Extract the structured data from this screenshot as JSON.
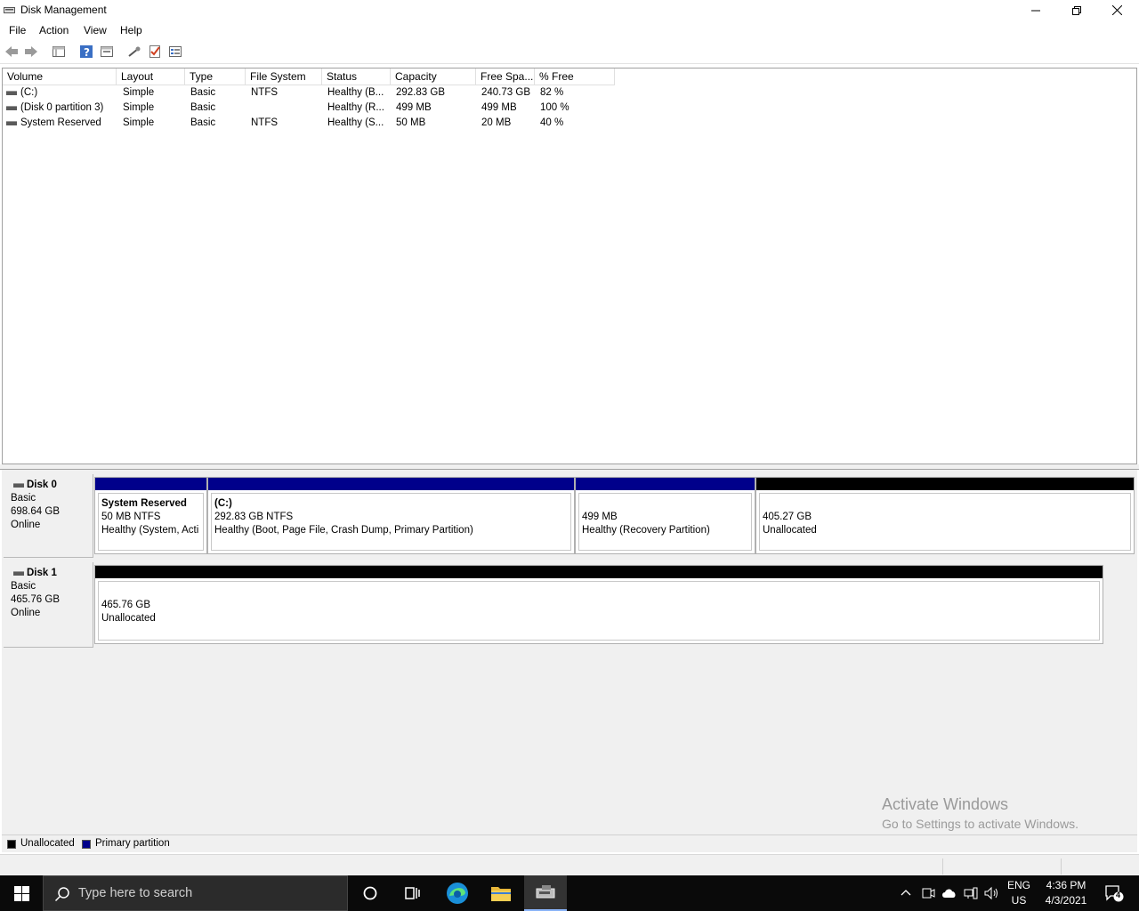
{
  "window": {
    "title": "Disk Management"
  },
  "menu": [
    "File",
    "Action",
    "View",
    "Help"
  ],
  "columns": [
    "Volume",
    "Layout",
    "Type",
    "File System",
    "Status",
    "Capacity",
    "Free Spa...",
    "% Free"
  ],
  "volumes": [
    {
      "volume": "(C:)",
      "layout": "Simple",
      "type": "Basic",
      "fs": "NTFS",
      "status": "Healthy (B...",
      "capacity": "292.83 GB",
      "free": "240.73 GB",
      "pct": "82 %"
    },
    {
      "volume": "(Disk 0 partition 3)",
      "layout": "Simple",
      "type": "Basic",
      "fs": "",
      "status": "Healthy (R...",
      "capacity": "499 MB",
      "free": "499 MB",
      "pct": "100 %"
    },
    {
      "volume": "System Reserved",
      "layout": "Simple",
      "type": "Basic",
      "fs": "NTFS",
      "status": "Healthy (S...",
      "capacity": "50 MB",
      "free": "20 MB",
      "pct": "40 %"
    }
  ],
  "disks": [
    {
      "name": "Disk 0",
      "type": "Basic",
      "size": "698.64 GB",
      "state": "Online",
      "partitions": [
        {
          "title": "System Reserved",
          "line2": "50 MB NTFS",
          "line3": "Healthy (System, Acti"
        },
        {
          "title": "(C:)",
          "line2": "292.83 GB NTFS",
          "line3": "Healthy (Boot, Page File, Crash Dump, Primary Partition)"
        },
        {
          "title": "",
          "line2": "499 MB",
          "line3": "Healthy (Recovery Partition)"
        },
        {
          "title": "",
          "line2": "405.27 GB",
          "line3": "Unallocated"
        }
      ]
    },
    {
      "name": "Disk 1",
      "type": "Basic",
      "size": "465.76 GB",
      "state": "Online",
      "partitions": [
        {
          "title": "",
          "line2": "465.76 GB",
          "line3": "Unallocated"
        }
      ]
    }
  ],
  "legend": [
    "Unallocated",
    "Primary partition"
  ],
  "watermark": {
    "line1": "Activate Windows",
    "line2": "Go to Settings to activate Windows."
  },
  "taskbar": {
    "search_placeholder": "Type here to search",
    "lang1": "ENG",
    "lang2": "US",
    "time": "4:36 PM",
    "date": "4/3/2021",
    "notifications": "4"
  },
  "colors": {
    "primary_partition": "#00008b",
    "unallocated": "#000000"
  }
}
